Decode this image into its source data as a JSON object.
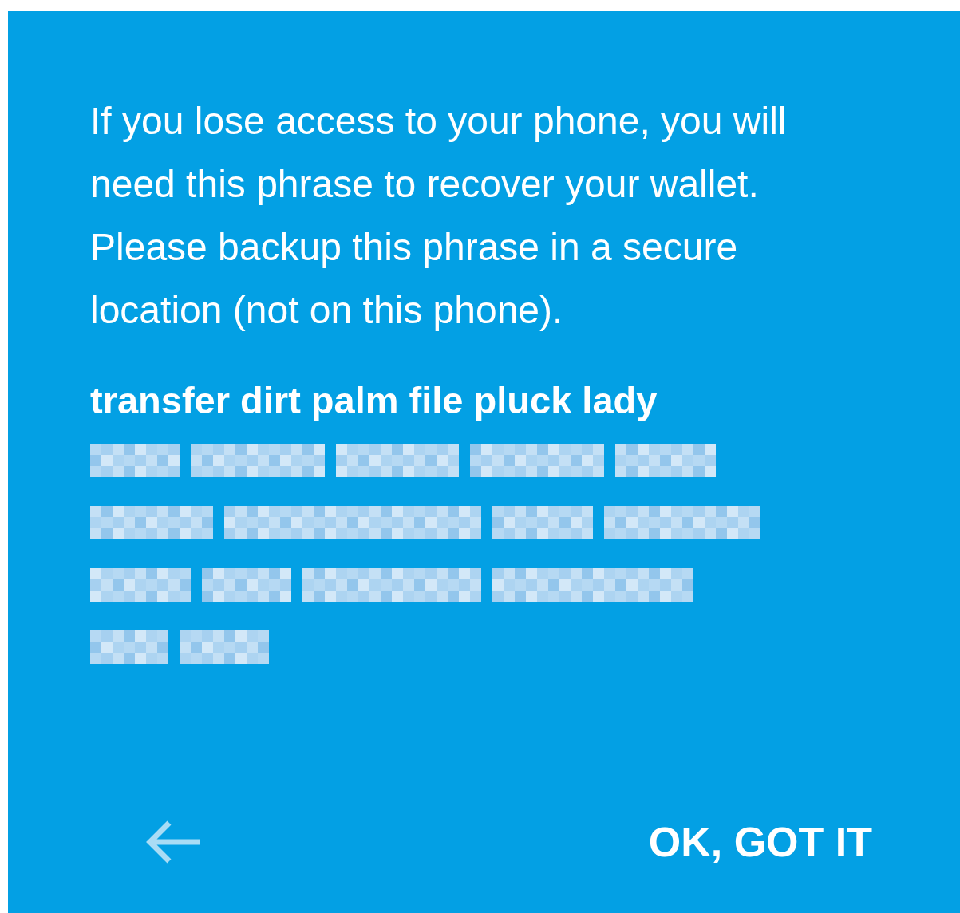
{
  "message": "If you lose access to your phone, you will need this phrase to recover your wallet. Please backup this phrase in a secure location (not on this phone).",
  "phrase_visible": "transfer dirt palm file pluck lady",
  "phrase_hidden": {
    "kind": "pixelated"
  },
  "actions": {
    "confirm": "OK, GOT IT"
  }
}
